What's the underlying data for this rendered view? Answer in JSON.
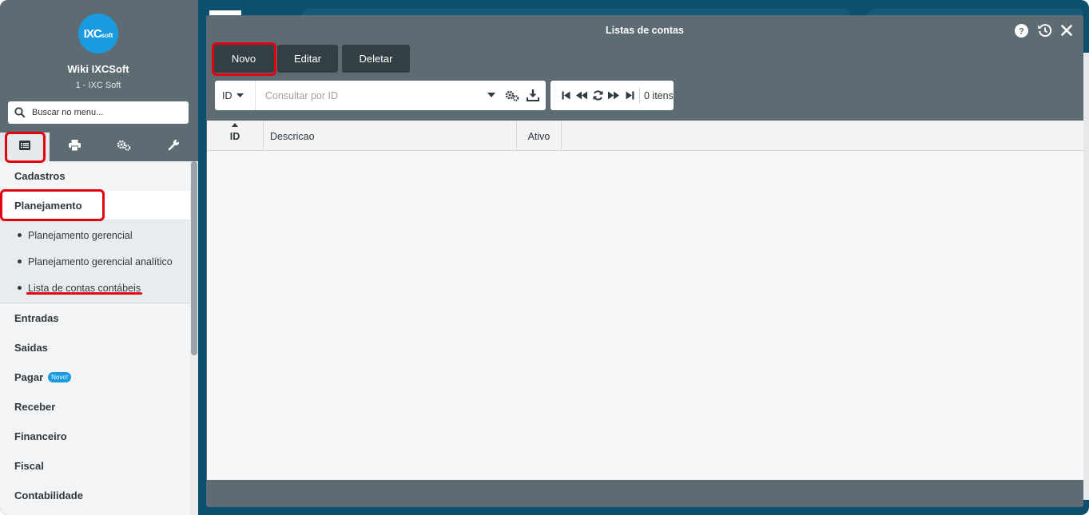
{
  "sidebar": {
    "logo_text": "IXC",
    "logo_sub": "soft",
    "company_name": "Wiki IXCSoft",
    "company_sub": "1 - IXC Soft",
    "search_placeholder": "Buscar no menu...",
    "tabs": [
      {
        "icon": "list-icon",
        "active": true
      },
      {
        "icon": "printer-icon",
        "active": false
      },
      {
        "icon": "gears-icon",
        "active": false
      },
      {
        "icon": "wrench-icon",
        "active": false
      }
    ],
    "categories": {
      "cadastros": "Cadastros",
      "planejamento": "Planejamento",
      "entradas": "Entradas",
      "saidas": "Saidas",
      "pagar": "Pagar",
      "pagar_badge": "Novo!",
      "receber": "Receber",
      "financeiro": "Financeiro",
      "fiscal": "Fiscal",
      "contabilidade": "Contabilidade"
    },
    "planejamento_items": [
      "Planejamento gerencial",
      "Planejamento gerencial analítico",
      "Lista de contas contábeis"
    ]
  },
  "window": {
    "title": "Listas de contas",
    "buttons": {
      "new": "Novo",
      "edit": "Editar",
      "delete": "Deletar"
    },
    "search": {
      "field": "ID",
      "placeholder": "Consultar por ID"
    },
    "pager": {
      "count": "0 itens"
    },
    "columns": [
      "ID",
      "Descricao",
      "Ativo"
    ]
  },
  "colors": {
    "sidebar_bg": "#5d6b72",
    "accent_blue": "#1a9be0",
    "dark_button": "#343f45",
    "highlight_red": "#e3000f"
  }
}
